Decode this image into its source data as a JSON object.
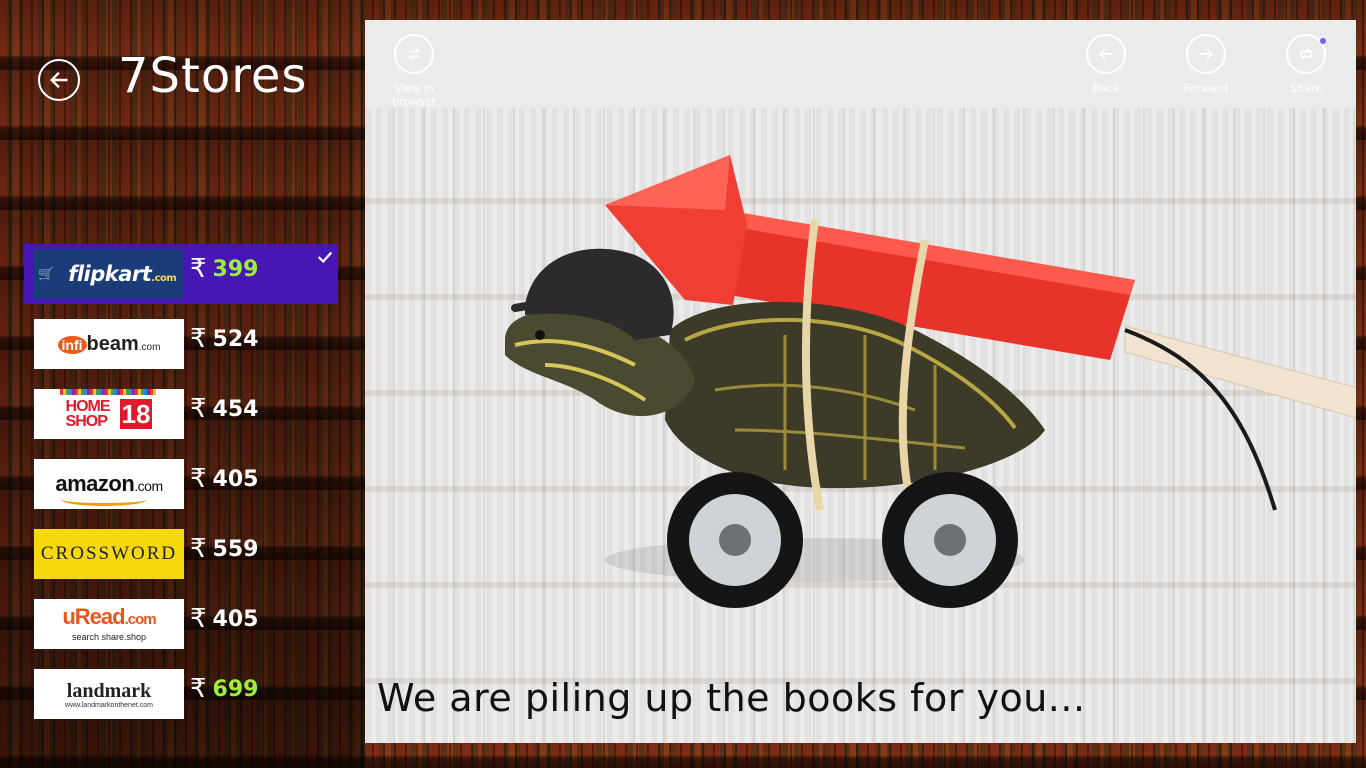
{
  "app": {
    "title": "7Stores"
  },
  "stores": [
    {
      "name": "flipkart",
      "logo_text": "flipkart",
      "logo_suffix": ".com",
      "currency": "₹",
      "price": "399",
      "selected": true
    },
    {
      "name": "infibeam",
      "logo_text": "beam",
      "logo_prefix": "infi",
      "logo_suffix": ".com",
      "currency": "₹",
      "price": "524"
    },
    {
      "name": "homeshop18",
      "logo_text": "HOME SHOP",
      "logo_suffix": "18",
      "currency": "₹",
      "price": "454"
    },
    {
      "name": "amazon",
      "logo_text": "amazon",
      "logo_suffix": ".com",
      "currency": "₹",
      "price": "405"
    },
    {
      "name": "crossword",
      "logo_text": "CROSSWORD",
      "currency": "₹",
      "price": "559"
    },
    {
      "name": "uread",
      "logo_text": "uRead",
      "logo_suffix": ".com",
      "logo_tagline": "search share.shop",
      "currency": "₹",
      "price": "405"
    },
    {
      "name": "landmark",
      "logo_text": "landmark",
      "logo_url": "www.landmarkonthenet.com",
      "currency": "₹",
      "price": "699"
    }
  ],
  "toolbar": {
    "view_in_browser": "View in browser",
    "back": "Back",
    "forward": "Forward",
    "share": "Share"
  },
  "web_content": {
    "loading_message": "We are piling up the books for you..."
  },
  "colors": {
    "selected_bg": "#4617b4",
    "best_price": "#9bf03c",
    "pane_bg": "#ebebeb"
  }
}
